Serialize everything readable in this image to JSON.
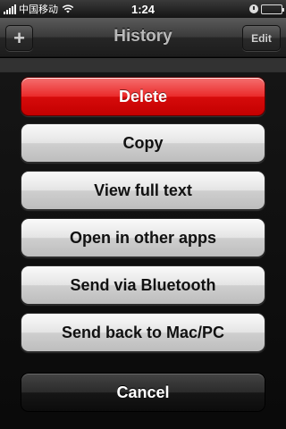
{
  "status_bar": {
    "carrier": "中国移动",
    "time": "1:24",
    "signal_bars": 5,
    "battery_level": 1.0
  },
  "nav_bar": {
    "title": "History",
    "left_button_label": "+",
    "right_button_label": "Edit"
  },
  "action_sheet": {
    "buttons": [
      {
        "label": "Delete",
        "style": "destructive",
        "color": "#e01010"
      },
      {
        "label": "Copy",
        "style": "default"
      },
      {
        "label": "View full text",
        "style": "default"
      },
      {
        "label": "Open in other apps",
        "style": "default"
      },
      {
        "label": "Send via Bluetooth",
        "style": "default"
      },
      {
        "label": "Send back to Mac/PC",
        "style": "default"
      }
    ],
    "cancel_label": "Cancel"
  },
  "icons": [
    "signal-bars-icon",
    "wifi-icon",
    "clock-icon",
    "battery-icon"
  ]
}
